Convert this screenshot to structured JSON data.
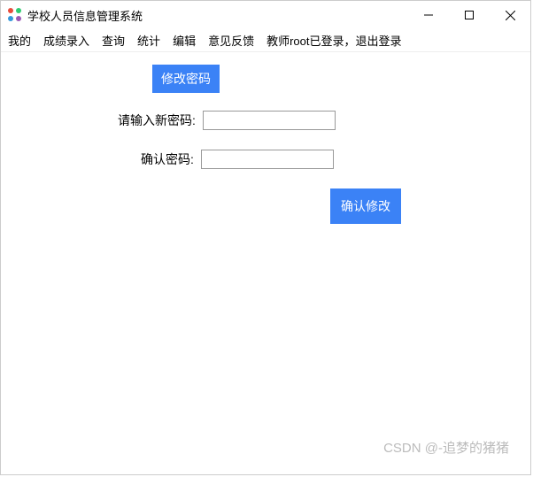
{
  "window": {
    "title": "学校人员信息管理系统"
  },
  "menubar": {
    "items": [
      "我的",
      "成绩录入",
      "查询",
      "统计",
      "编辑",
      "意见反馈",
      "教师root已登录，退出登录"
    ]
  },
  "section": {
    "title": "修改密码"
  },
  "form": {
    "new_password_label": "请输入新密码:",
    "new_password_value": "",
    "confirm_password_label": "确认密码:",
    "confirm_password_value": "",
    "submit_label": "确认修改"
  },
  "watermark": "CSDN @-追梦的猪猪"
}
